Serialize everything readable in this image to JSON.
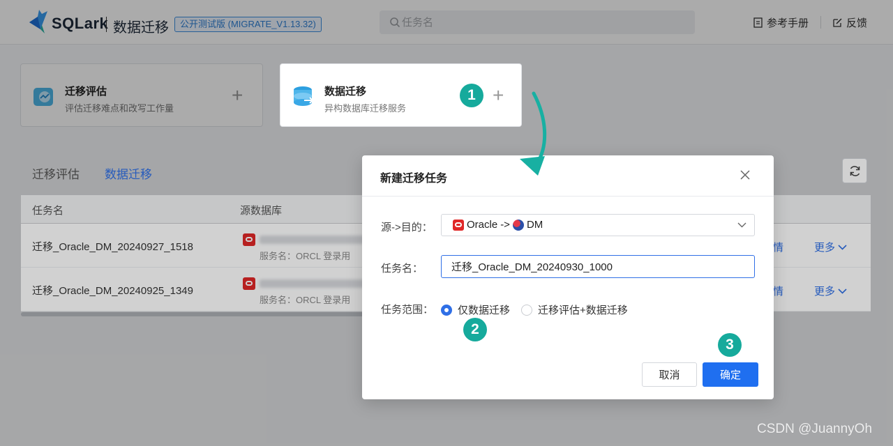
{
  "header": {
    "brand": "SQLark",
    "product": "数据迁移",
    "version_badge": "公开测试版 (MIGRATE_V1.13.32)",
    "search_placeholder": "任务名",
    "manual_label": "参考手册",
    "feedback_label": "反馈"
  },
  "cards": [
    {
      "title": "迁移评估",
      "desc": "评估迁移难点和改写工作量",
      "plus": "+"
    },
    {
      "title": "数据迁移",
      "desc": "异构数据库迁移服务",
      "plus": "+"
    }
  ],
  "tabs": [
    {
      "label": "迁移评估",
      "active": false
    },
    {
      "label": "数据迁移",
      "active": true
    }
  ],
  "table": {
    "columns": [
      "任务名",
      "源数据库"
    ],
    "rows": [
      {
        "name": "迁移_Oracle_DM_20240927_1518",
        "sub": "服务名：ORCL   登录用",
        "detail": "情",
        "more": "更多"
      },
      {
        "name": "迁移_Oracle_DM_20240925_1349",
        "sub": "服务名：ORCL   登录用",
        "detail": "情",
        "more": "更多"
      }
    ]
  },
  "modal": {
    "title": "新建迁移任务",
    "source_target_label": "源->目的：",
    "source_name": "Oracle",
    "arrow_text": "->",
    "target_name": "DM",
    "task_name_label": "任务名：",
    "task_name_value": "迁移_Oracle_DM_20240930_1000",
    "scope_label": "任务范围：",
    "scope_options": [
      {
        "label": "仅数据迁移",
        "checked": true
      },
      {
        "label": "迁移评估+数据迁移",
        "checked": false
      }
    ],
    "cancel_label": "取消",
    "ok_label": "确定"
  },
  "steps": [
    "1",
    "2",
    "3"
  ],
  "watermark": "CSDN @JuannyOh",
  "colors": {
    "accent": "#1f6ff0",
    "step": "#16aa9c",
    "oracle": "#e02828"
  }
}
